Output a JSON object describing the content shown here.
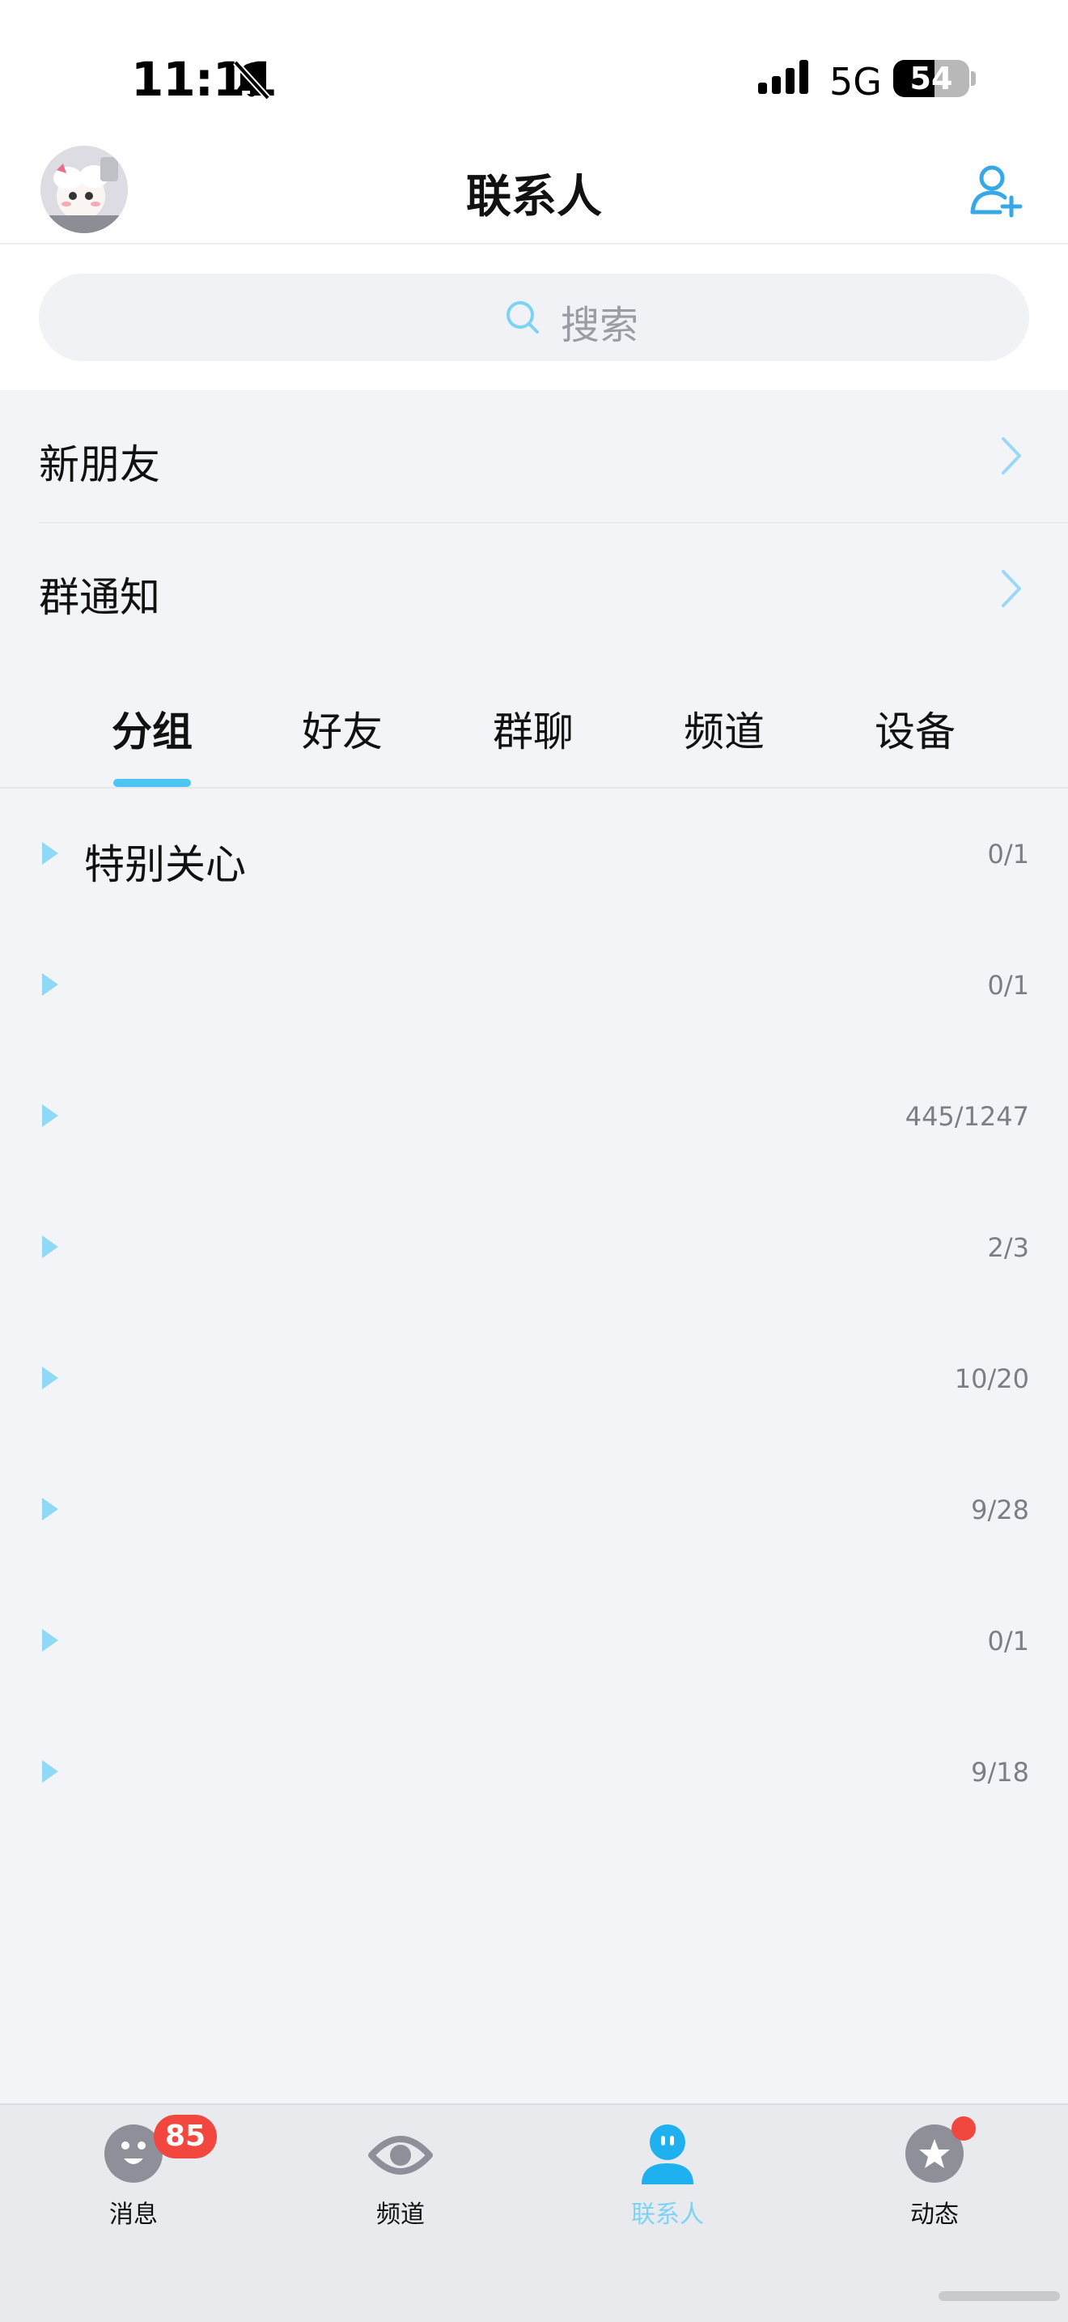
{
  "status_bar": {
    "time": "11:11",
    "network": "5G",
    "battery_level": 54,
    "battery_label": "54"
  },
  "header": {
    "title": "联系人"
  },
  "search": {
    "placeholder": "搜索"
  },
  "nav_rows": [
    {
      "label": "新朋友"
    },
    {
      "label": "群通知"
    }
  ],
  "tabs": [
    {
      "label": "分组",
      "active": true
    },
    {
      "label": "好友",
      "active": false
    },
    {
      "label": "群聊",
      "active": false
    },
    {
      "label": "频道",
      "active": false
    },
    {
      "label": "设备",
      "active": false
    }
  ],
  "groups": [
    {
      "name": "特别关心",
      "count": "0/1"
    },
    {
      "name": "",
      "count": "0/1"
    },
    {
      "name": "",
      "count": "445/1247"
    },
    {
      "name": "",
      "count": "2/3"
    },
    {
      "name": "",
      "count": "10/20"
    },
    {
      "name": "",
      "count": "9/28"
    },
    {
      "name": "",
      "count": "0/1"
    },
    {
      "name": "",
      "count": "9/18"
    }
  ],
  "bottom_tabs": [
    {
      "label": "消息",
      "icon": "message-icon",
      "badge": "85",
      "active": false
    },
    {
      "label": "频道",
      "icon": "channel-icon",
      "active": false
    },
    {
      "label": "联系人",
      "icon": "contacts-icon",
      "active": true
    },
    {
      "label": "动态",
      "icon": "moments-icon",
      "dot": true,
      "active": false
    }
  ],
  "colors": {
    "accent": "#4dc7f2",
    "active_tab_label": "#7dd3f4",
    "badge": "#f2473e",
    "background": "#f3f4f8"
  }
}
